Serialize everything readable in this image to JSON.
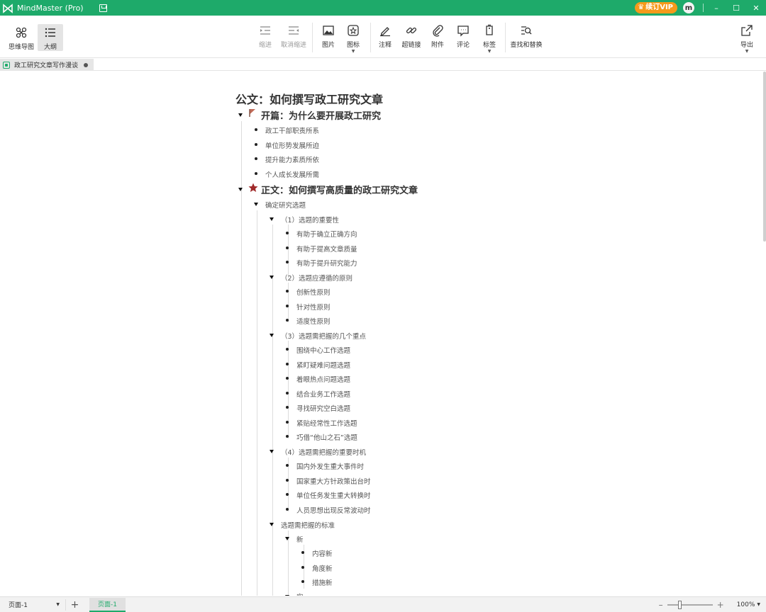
{
  "app": {
    "title": "MindMaster (Pro)",
    "vip_label": "续订VIP",
    "avatar_letter": "m",
    "window_min": "–",
    "window_max": "☐",
    "window_close": "✕",
    "brand_color": "#1eaa6a",
    "vip_color": "#f59a1b"
  },
  "toolbar": {
    "view_mindmap": "思维导图",
    "view_outline": "大纲",
    "indent": "缩进",
    "outdent": "取消缩进",
    "picture": "图片",
    "icon": "图标",
    "note": "注释",
    "hyperlink": "超链接",
    "attachment": "附件",
    "comment": "评论",
    "tag": "标签",
    "find_replace": "查找和替换",
    "export": "导出"
  },
  "doc_tab": {
    "title": "政工研究文章写作漫谈"
  },
  "outline": {
    "root": "公文：如何撰写政工研究文章",
    "section1": {
      "title": "开篇：为什么要开展政工研究",
      "icon": "flag-icon",
      "items": [
        "政工干部职责所系",
        "单位形势发展所迫",
        "提升能力素质所依",
        "个人成长发展所需"
      ]
    },
    "section2": {
      "title": "正文：如何撰写高质量的政工研究文章",
      "icon": "star-icon",
      "sub1": {
        "title": "确定研究选题",
        "g1": {
          "title": "（1）选题的重要性",
          "items": [
            "有助于确立正确方向",
            "有助于提高文章质量",
            "有助于提升研究能力"
          ]
        },
        "g2": {
          "title": "（2）选题应遵循的原则",
          "items": [
            "创新性原则",
            "针对性原则",
            "适度性原则"
          ]
        },
        "g3": {
          "title": "（3）选题需把握的几个重点",
          "items": [
            "围绕中心工作选题",
            "紧盯疑难问题选题",
            "着眼热点问题选题",
            "结合业务工作选题",
            "寻找研究空白选题",
            "紧贴经常性工作选题",
            "巧借“他山之石”选题"
          ]
        },
        "g4": {
          "title": "（4）选题需把握的重要时机",
          "items": [
            "国内外发生重大事件时",
            "国家重大方针政策出台时",
            "单位任务发生重大转换时",
            "人员思想出现反常波动时"
          ]
        },
        "g5": {
          "title": "选题需把握的标准",
          "h1": {
            "title": "新",
            "items": [
              "内容新",
              "角度新",
              "措施新"
            ]
          },
          "h2": {
            "title": "实"
          }
        }
      }
    }
  },
  "status": {
    "page_select": "页面-1",
    "page_add": "+",
    "page_tab": "页面-1",
    "zoom_minus": "–",
    "zoom_plus": "+",
    "zoom": "100%",
    "zoom_fraction": 0.25
  }
}
